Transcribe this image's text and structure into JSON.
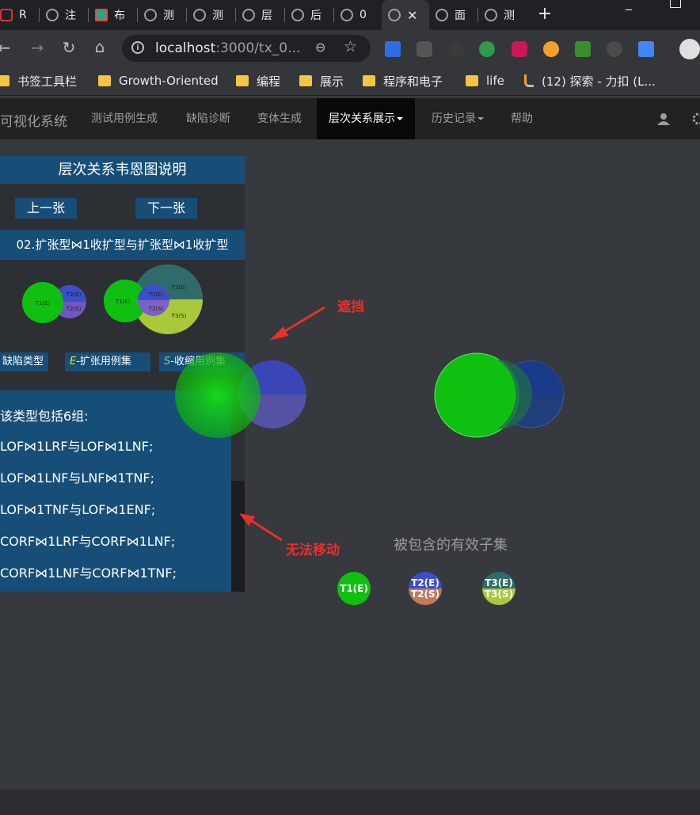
{
  "tabs": [
    {
      "label": "R"
    },
    {
      "label": "注"
    },
    {
      "label": "布"
    },
    {
      "label": "测"
    },
    {
      "label": "测"
    },
    {
      "label": "层"
    },
    {
      "label": "后"
    },
    {
      "label": "0"
    },
    {
      "label": ""
    },
    {
      "label": "面"
    },
    {
      "label": "测"
    }
  ],
  "toolbar": {
    "url_host": "localhost",
    "url_rest": ":3000/tx_0...",
    "url_icon": "info-icon"
  },
  "bookmarks": [
    {
      "label": "书签工具栏",
      "icon": "folder-icon"
    },
    {
      "label": "Growth-Oriented",
      "icon": "folder-icon"
    },
    {
      "label": "编程",
      "icon": "folder-icon"
    },
    {
      "label": "展示",
      "icon": "folder-icon"
    },
    {
      "label": "程序和电子",
      "icon": "folder-icon"
    },
    {
      "label": "life",
      "icon": "folder-icon"
    },
    {
      "label": "(12) 探索 - 力扣 (L...",
      "icon": "leetcode-icon"
    }
  ],
  "nav": {
    "brand": "可视化系统",
    "items": [
      {
        "label": "测试用例生成"
      },
      {
        "label": "缺陷诊断"
      },
      {
        "label": "变体生成"
      },
      {
        "label": "层次关系展示"
      },
      {
        "label": "历史记录"
      },
      {
        "label": "帮助"
      }
    ]
  },
  "panel": {
    "title": "层次关系韦恩图说明",
    "prev": "上一张",
    "next": "下一张",
    "subtitle": "02.扩张型⋈1收扩型与扩张型⋈1收扩型",
    "venn_labels": {
      "t1e": "T1(E)",
      "t2e": "T2(E)",
      "t2s": "T2(S)",
      "t3e": "T3(E)",
      "t3s": "T3(S)"
    },
    "legend": {
      "fault": "缺陷类型",
      "e_letter": "E",
      "e_text": "-扩张用例集",
      "s_letter": "S",
      "s_text": "-收缩用例集"
    },
    "desc_lines": [
      "该类型包括6组:",
      "LOF⋈1LRF与LOF⋈1LNF;",
      "LOF⋈1LNF与LNF⋈1TNF;",
      "LOF⋈1TNF与LOF⋈1ENF;",
      "CORF⋈1LRF与CORF⋈1LNF;",
      "CORF⋈1LNF与CORF⋈1TNF;"
    ]
  },
  "annotations": {
    "occlude": "遮挡",
    "cannot_move": "无法移动"
  },
  "main": {
    "caption": "被包含的有效子集",
    "dots": [
      {
        "line1": "T1(E)",
        "line2": ""
      },
      {
        "line1": "T2(E)",
        "line2": "T2(S)"
      },
      {
        "line1": "T3(E)",
        "line2": "T3(S)"
      }
    ]
  },
  "colors": {
    "accent": "#174e78",
    "green": "#10c010",
    "navy": "#1c3a8a",
    "annot": "#e8302b"
  }
}
